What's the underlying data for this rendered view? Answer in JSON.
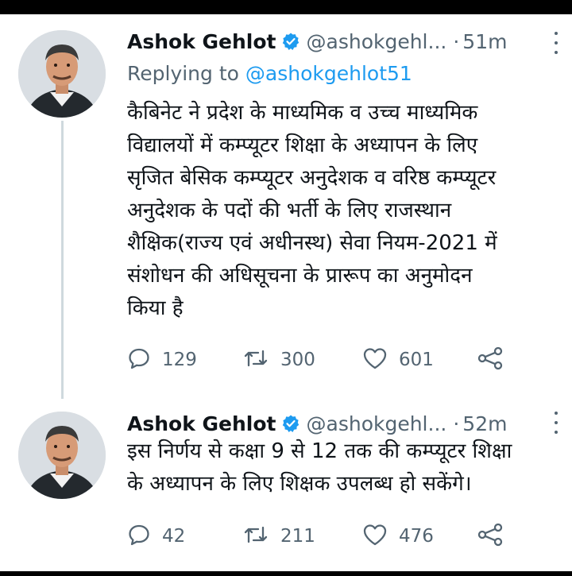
{
  "tweets": [
    {
      "name": "Ashok Gehlot",
      "handle": "@ashokgehl...",
      "separator": "·",
      "time": "51m",
      "replying_prefix": "Replying to ",
      "replying_to": "@ashokgehlot51",
      "text_lines": [
        "कैबिनेट ने प्रदेश के माध्यमिक व उच्च माध्यमिक",
        "विद्यालयों में कम्प्यूटर शिक्षा के अध्यापन के लिए",
        "सृजित बेसिक कम्प्यूटर अनुदेशक व वरिष्ठ कम्प्यूटर",
        "अनुदेशक के पदों की भर्ती के लिए राजस्थान",
        "शैक्षिक(राज्य एवं अधीनस्थ) सेवा नियम-2021 में",
        "संशोधन की अधिसूचना के प्रारूप का अनुमोदन",
        "किया है"
      ],
      "replies": "129",
      "retweets": "300",
      "likes": "601"
    },
    {
      "name": "Ashok Gehlot",
      "handle": "@ashokgehl...",
      "separator": "·",
      "time": "52m",
      "text_lines": [
        "इस निर्णय से कक्षा 9 से 12 तक की कम्प्यूटर शिक्षा",
        "के अध्यापन के लिए शिक्षक उपलब्ध हो सकेंगे।"
      ],
      "replies": "42",
      "retweets": "211",
      "likes": "476"
    }
  ],
  "icons": {
    "reply": "reply-icon",
    "retweet": "retweet-icon",
    "like": "heart-icon",
    "share": "share-icon",
    "verified": "verified-badge-icon",
    "more": "more-options-icon"
  },
  "colors": {
    "text": "#0f1419",
    "secondary": "#536471",
    "link": "#1d9bf0",
    "verified": "#1d9bf0",
    "thread_line": "#cfd9de"
  }
}
